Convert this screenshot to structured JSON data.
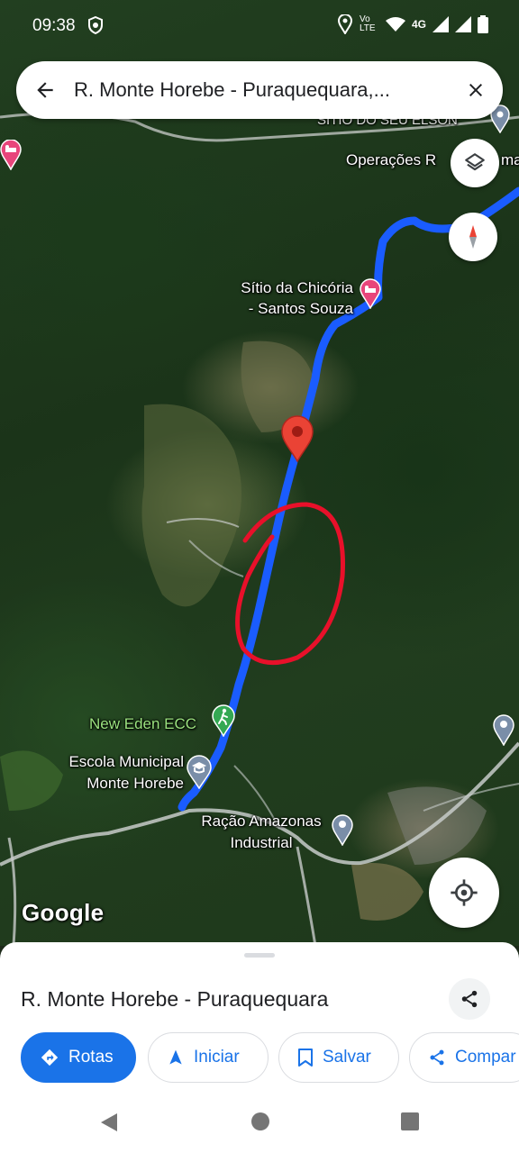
{
  "status_bar": {
    "time": "09:38",
    "network": "4G",
    "volte": "Vo LTE"
  },
  "search": {
    "query": "R. Monte Horebe - Puraquequara,..."
  },
  "map": {
    "labels": {
      "sitio_seu_elson": "SÍTIO DO SEU ELSON",
      "operacoes": "Operações R",
      "operacoes_tail": "mas",
      "chicoria_line1": "Sítio da Chicória",
      "chicoria_line2": "- Santos Souza",
      "new_eden": "New Eden ECC",
      "escola_line1": "Escola Municipal",
      "escola_line2": "Monte Horebe",
      "racao_line1": "Ração Amazonas",
      "racao_line2": "Industrial"
    },
    "attribution": "Google",
    "route_color": "#1a5cff",
    "annotation_color": "#e8102a",
    "pin_color": "#ea4335"
  },
  "sheet": {
    "title": "R. Monte Horebe - Puraquequara",
    "actions": {
      "directions": "Rotas",
      "start": "Iniciar",
      "save": "Salvar",
      "share": "Compar"
    }
  },
  "icons": [
    "back-arrow-icon",
    "close-icon",
    "layers-icon",
    "compass-icon",
    "my-location-icon",
    "share-icon",
    "directions-icon",
    "navigation-arrow-icon",
    "bookmark-icon",
    "hotel-icon",
    "hiking-icon",
    "school-icon",
    "place-icon"
  ]
}
